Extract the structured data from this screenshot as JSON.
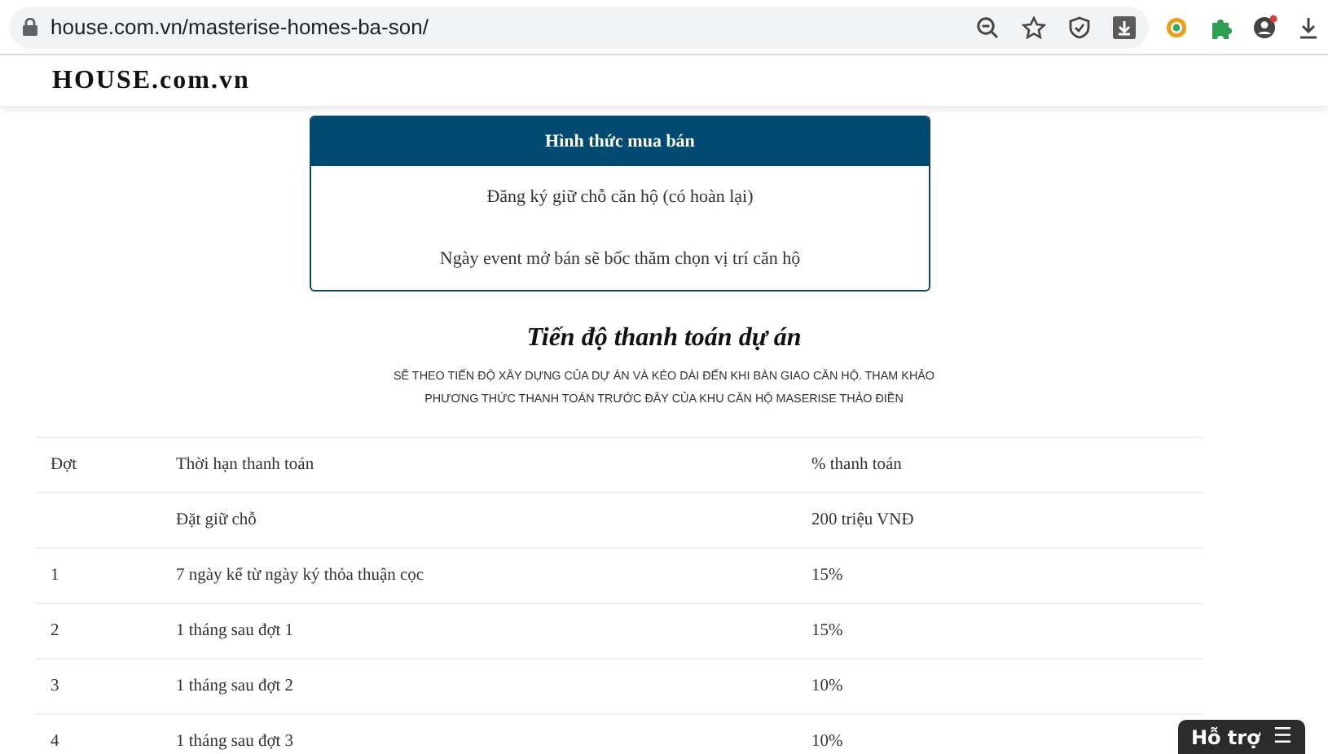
{
  "browser": {
    "url": "house.com.vn/masterise-homes-ba-son/"
  },
  "site": {
    "logo": "HOUSE.com.vn"
  },
  "sale_box": {
    "title": "Hình thức mua bán",
    "lines": [
      "Đăng ký giữ chỗ căn hộ (có hoàn lại)",
      "Ngày event mở bán sẽ bốc thăm chọn vị trí căn hộ"
    ]
  },
  "payment": {
    "title": "Tiến độ thanh toán dự án",
    "subtitle": "SẼ THEO TIẾN ĐỘ XÂY DỰNG CỦA DỰ ÁN VÀ KÉO DÀI ĐẾN KHI BÀN GIAO CĂN HỘ. THAM KHẢO PHƯƠNG THỨC THANH TOÁN TRƯỚC ĐÂY CỦA KHU CĂN HỘ MASERISE THẢO ĐIỀN",
    "table": {
      "columns": [
        "Đợt",
        "Thời hạn thanh toán",
        "% thanh toán"
      ],
      "rows": [
        [
          "",
          "Đặt giữ chỗ",
          "200 triệu VNĐ"
        ],
        [
          "1",
          "7 ngày kể từ ngày ký thỏa thuận cọc",
          "15%"
        ],
        [
          "2",
          "1 tháng sau đợt 1",
          "15%"
        ],
        [
          "3",
          "1 tháng sau đợt 2",
          "10%"
        ],
        [
          "4",
          "1 tháng sau đợt 3",
          "10%"
        ]
      ]
    }
  },
  "help_button": {
    "label": "Hỗ trợ",
    "icon": "☰"
  }
}
